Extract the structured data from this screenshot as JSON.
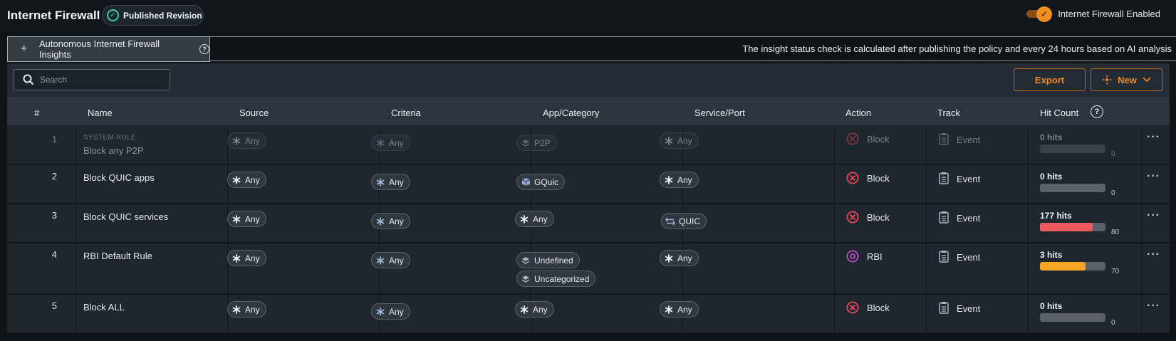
{
  "header": {
    "title": "Internet Firewall",
    "badge": "Published Revision",
    "toggle_label": "Internet Firewall Enabled"
  },
  "insights": {
    "tab_label": "Autonomous Internet Firewall Insights",
    "note": "The insight status check is calculated after publishing the policy and every 24 hours based on AI analysis"
  },
  "toolbar": {
    "search_placeholder": "Search",
    "export_label": "Export",
    "new_label": "New"
  },
  "columns": {
    "num": "#",
    "name": "Name",
    "source": "Source",
    "criteria": "Criteria",
    "app": "App/Category",
    "service": "Service/Port",
    "action": "Action",
    "track": "Track",
    "hits": "Hit Count"
  },
  "rows": [
    {
      "num": "1",
      "system_tag": "SYSTEM RULE",
      "name": "Block any P2P",
      "source": "Any",
      "criteria": "Any",
      "app": [
        "P2P"
      ],
      "service": "Any",
      "action": "Block",
      "track": "Event",
      "hits_label": "0 hits",
      "hits_value": "0",
      "hits_fraction": 0
    },
    {
      "num": "2",
      "name": "Block QUIC apps",
      "source": "Any",
      "criteria": "Any",
      "app": [
        "GQuic"
      ],
      "service": "Any",
      "action": "Block",
      "track": "Event",
      "hits_label": "0 hits",
      "hits_value": "0",
      "hits_fraction": 0
    },
    {
      "num": "3",
      "name": "Block QUIC services",
      "source": "Any",
      "criteria": "Any",
      "app": [
        "Any"
      ],
      "service": "QUIC",
      "action": "Block",
      "track": "Event",
      "hits_label": "177 hits",
      "hits_value": "80",
      "hits_fraction": 0.8
    },
    {
      "num": "4",
      "name": "RBI Default Rule",
      "source": "Any",
      "criteria": "Any",
      "app": [
        "Undefined",
        "Uncategorized"
      ],
      "service": "Any",
      "action": "RBI",
      "track": "Event",
      "hits_label": "3 hits",
      "hits_value": "70",
      "hits_fraction": 0.7
    },
    {
      "num": "5",
      "name": "Block ALL",
      "source": "Any",
      "criteria": "Any",
      "app": [
        "Any"
      ],
      "service": "Any",
      "action": "Block",
      "track": "Event",
      "hits_label": "0 hits",
      "hits_value": "0",
      "hits_fraction": 0
    }
  ],
  "colors": {
    "accent": "#f08a2a",
    "block": "#e8485a",
    "rbi": "#c04fc7",
    "hits_high": "#ef5a5f",
    "hits_mid": "#f5a524"
  },
  "icons": {
    "published": "check-circle-icon",
    "toggle": "check-icon",
    "any": "asterisk-icon",
    "category": "layers-icon",
    "app": "cube-icon",
    "service": "arrows-exchange-icon",
    "block": "x-circle-icon",
    "rbi": "target-circle-icon",
    "track": "clipboard-icon",
    "more": "ellipsis-icon",
    "new": "sparkle-icon",
    "search": "search-icon"
  }
}
